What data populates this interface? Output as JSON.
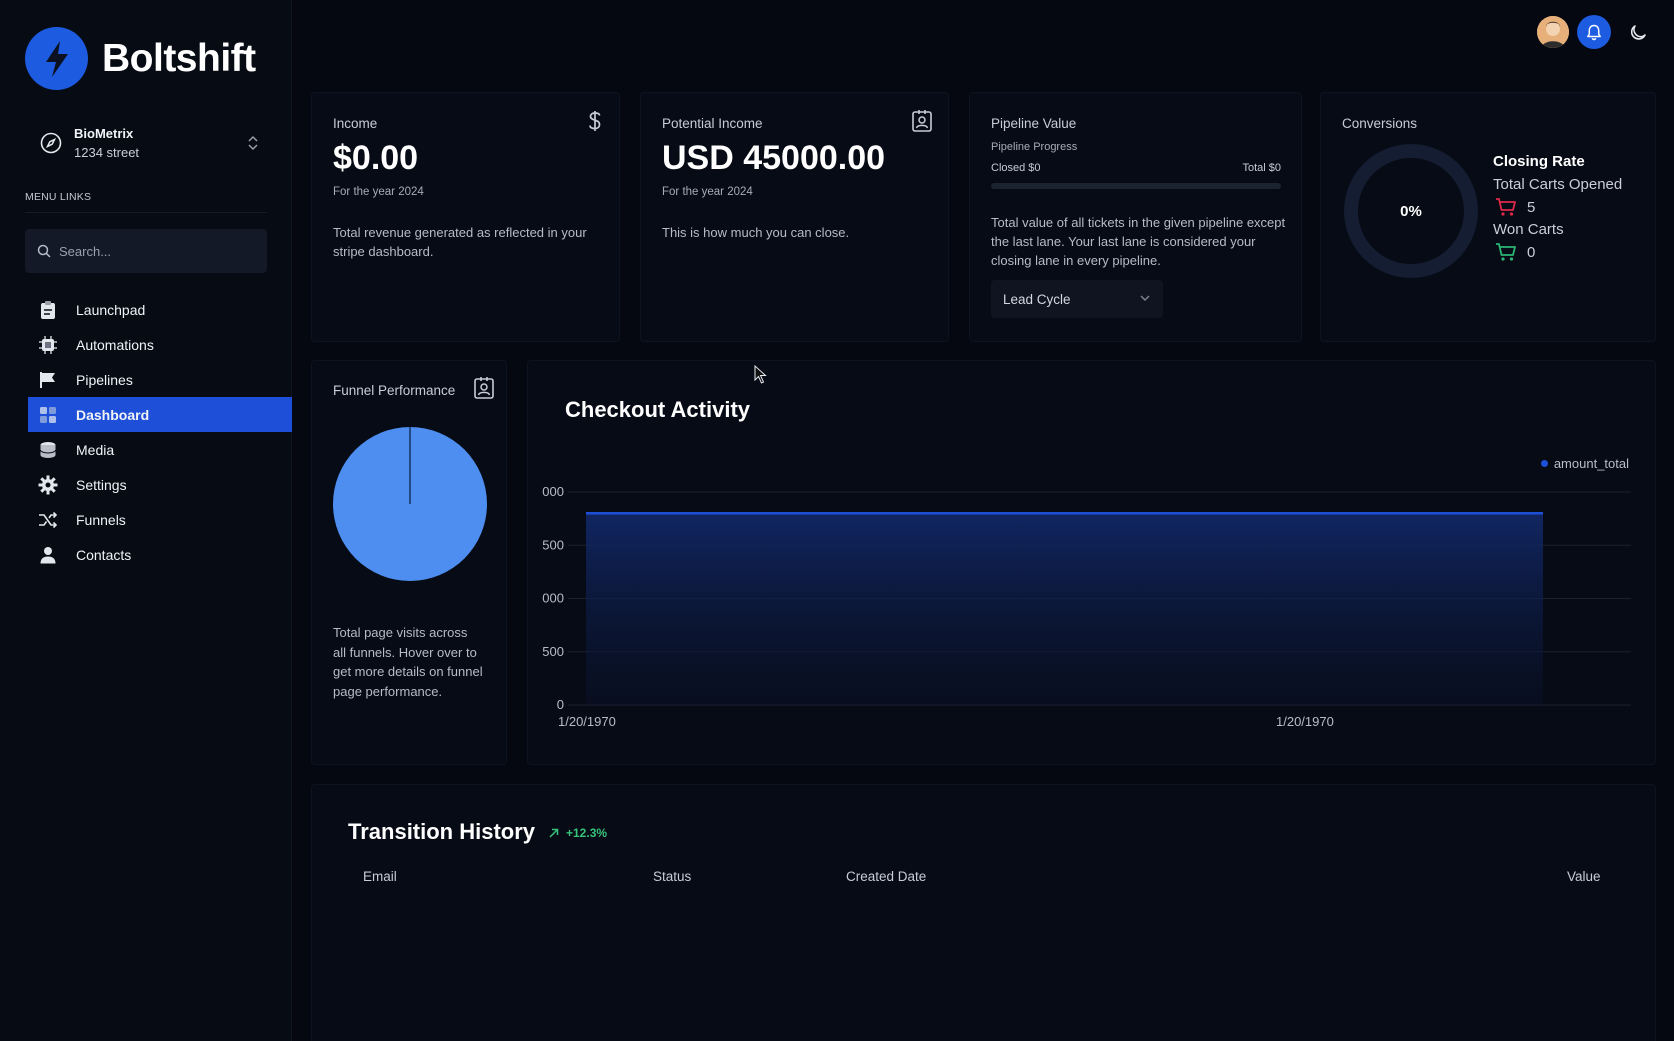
{
  "app": {
    "name": "Boltshift"
  },
  "org": {
    "name": "BioMetrix",
    "address": "1234 street"
  },
  "sidebar": {
    "menu_label": "MENU LINKS",
    "search_placeholder": "Search...",
    "items": [
      {
        "label": "Launchpad",
        "icon": "clipboard-icon",
        "active": false
      },
      {
        "label": "Automations",
        "icon": "chip-icon",
        "active": false
      },
      {
        "label": "Pipelines",
        "icon": "flag-icon",
        "active": false
      },
      {
        "label": "Dashboard",
        "icon": "grid-icon",
        "active": true
      },
      {
        "label": "Media",
        "icon": "database-icon",
        "active": false
      },
      {
        "label": "Settings",
        "icon": "gear-icon",
        "active": false
      },
      {
        "label": "Funnels",
        "icon": "shuffle-icon",
        "active": false
      },
      {
        "label": "Contacts",
        "icon": "user-icon",
        "active": false
      }
    ]
  },
  "topbar": {
    "icons": [
      "avatar",
      "bell-icon",
      "moon-icon"
    ]
  },
  "cards": {
    "income": {
      "title": "Income",
      "value": "$0.00",
      "period": "For the year 2024",
      "description": "Total revenue generated as reflected in your stripe dashboard."
    },
    "potential": {
      "title": "Potential Income",
      "value": "USD 45000.00",
      "period": "For the year 2024",
      "description": "This is how much you can close."
    },
    "pipeline": {
      "title": "Pipeline Value",
      "progress_label": "Pipeline Progress",
      "closed": "Closed $0",
      "total": "Total $0",
      "progress": 0,
      "description": "Total value of all tickets in the given pipeline except the last lane. Your last lane is considered your closing lane in every pipeline.",
      "select_value": "Lead Cycle"
    },
    "conversions": {
      "title": "Conversions",
      "percent": "0%",
      "closing_rate": "Closing Rate",
      "total_carts_label": "Total Carts Opened",
      "total_carts": "5",
      "won_carts_label": "Won Carts",
      "won_carts": "0"
    },
    "funnel": {
      "title": "Funnel Performance",
      "description": "Total page visits across all funnels. Hover over to get more details on funnel page performance."
    }
  },
  "chart_data": {
    "type": "area",
    "title": "Checkout Activity",
    "legend": [
      "amount_total"
    ],
    "legend_position": "top-right",
    "y_tick_labels": [
      "0",
      "500",
      "000",
      "500",
      "000"
    ],
    "x_tick_labels": [
      "1/20/1970",
      "1/20/1970"
    ],
    "series": [
      {
        "name": "amount_total",
        "color": "#1d4fd8",
        "x": [
          "1/20/1970",
          "1/20/1970"
        ],
        "values": [
          1800,
          1800
        ]
      }
    ],
    "ylim": [
      0,
      2000
    ],
    "grid": true
  },
  "transition_history": {
    "title": "Transition History",
    "delta": "+12.3%",
    "columns": [
      "Email",
      "Status",
      "Created Date",
      "Value"
    ]
  },
  "colors": {
    "accent": "#1d5be0",
    "active_nav": "#1d4fd8",
    "pie": "#4d8ef0",
    "positive": "#37c47a",
    "cart_red": "#e0284a",
    "cart_green": "#2bb673"
  }
}
